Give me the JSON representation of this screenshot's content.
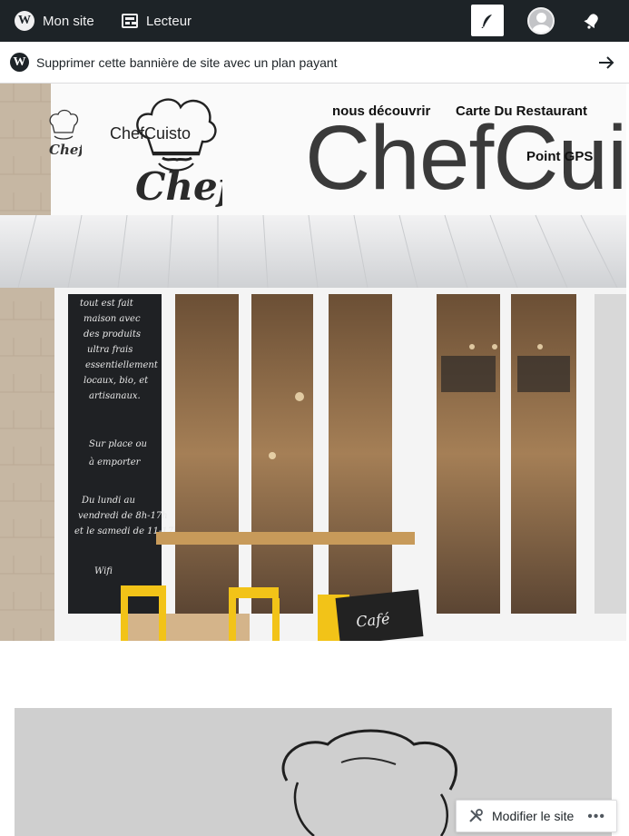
{
  "admin_bar": {
    "my_site_label": "Mon site",
    "reader_label": "Lecteur",
    "write_icon": "feather-icon",
    "notifications_icon": "bell-icon"
  },
  "banner": {
    "text": "Supprimer cette bannière de site avec un plan payant",
    "arrow_icon": "arrow-right-icon"
  },
  "site": {
    "title": "ChefCuisto",
    "big_title_visible": "ChefCui",
    "logo_text": "Chef",
    "nav": {
      "item1": "nous découvrir",
      "item2": "Carte Du Restaurant",
      "item3": "Point GPS"
    }
  },
  "edit_bar": {
    "label": "Modifier le site",
    "more": "•••"
  },
  "colors": {
    "admin_bar_bg": "#1d2327",
    "awning": "#e4e5e7",
    "chair_yellow": "#f2c318"
  }
}
